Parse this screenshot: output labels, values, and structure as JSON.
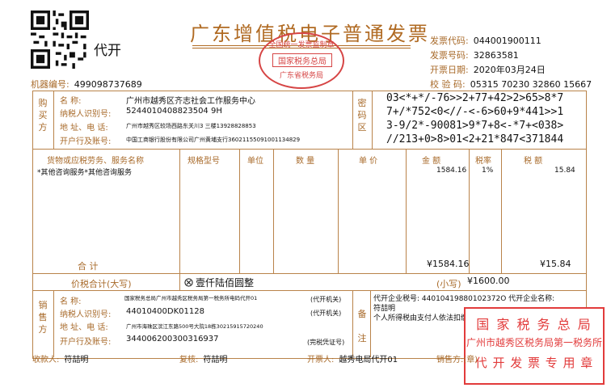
{
  "header": {
    "title": "广东增值税电子普通发票",
    "daikai": "代开",
    "seal_lines": [
      "全国统一发票监制章",
      "国家税务总局",
      "广东省税务局"
    ],
    "invoice_code_label": "发票代码:",
    "invoice_code": "044001900111",
    "invoice_no_label": "发票号码:",
    "invoice_no": "32863581",
    "date_label": "开票日期:",
    "date": "2020年03月24日",
    "check_label": "校 验 码:",
    "check_code": "05315 70230 32860 15667",
    "machine_label": "机器编号:",
    "machine_no": "499098737689"
  },
  "buyer": {
    "section_label": "购买方",
    "name_label": "名    称:",
    "name": "广州市越秀区齐志社会工作服务中心",
    "tax_id_label": "纳税人识别号:",
    "tax_id": "5244010408823504 9H",
    "addr_label": "地 址、电 话:",
    "addr": "广州市越秀区较场西路东关川3 三楼13928828853",
    "bank_label": "开户行及账号:",
    "bank": "中国工商银行股份有限公司广州黄埔支行36021155091001134829"
  },
  "cipher": {
    "section_label": "密码区",
    "lines": [
      "03<*+*/-76>>2+77+42>2>65>8*7",
      "7+/*752<0<//-<-6>60+9*441>>1",
      "3-9/2*-90081>9*7+8<-*7+<038>",
      "//213+0>8>01<2+21*847<371844"
    ]
  },
  "columns": {
    "goods": "货物或应税劳务、服务名称",
    "spec": "规格型号",
    "unit": "单位",
    "qty": "数 量",
    "price": "单 价",
    "amount": "金 额",
    "rate": "税率",
    "tax": "税 额"
  },
  "items": [
    {
      "goods": "*其他咨询服务*其他咨询服务",
      "amount": "1584.16",
      "rate": "1%",
      "tax": "15.84"
    }
  ],
  "totals": {
    "label": "合   计",
    "amount": "¥1584.16",
    "tax": "¥15.84",
    "grand_label": "价税合计(大写)",
    "grand_upper": "壹仟陆佰圆整",
    "grand_small_label": "(小写)",
    "grand_small": "¥1600.00"
  },
  "seller": {
    "section_label": "销售方",
    "name_label": "名    称:",
    "name": "国家税务总局广州市越秀区税务局第一税务所电码代开01",
    "name_tag": "(代开机关)",
    "tax_id_label": "纳税人识别号:",
    "tax_id": "44010400DK01128",
    "tax_id_tag": "(代开机关)",
    "addr_label": "地 址、电 话:",
    "addr": "广州市海珠区滨江东路500号大院18栋30215915720240",
    "bank_label": "开户行及账号:",
    "bank": "344006200300316937",
    "bank_tag": "(完税凭证号)"
  },
  "remarks": {
    "section_label": "备注",
    "line1": "代开企业税号: 44010419880102372O 代开企业名称:",
    "line2": "符喆明",
    "line3": "个人所得税由支付人依法扣缴"
  },
  "stamp": {
    "line1": "国 家 税 务 总 局",
    "line2": "广州市越秀区税务局第一税务所",
    "line3": "代 开 发 票 专 用 章"
  },
  "footer": {
    "payee_label": "收款人:",
    "payee": "符喆明",
    "reviewer_label": "复核:",
    "reviewer": "符喆明",
    "drawer_label": "开票人:",
    "drawer": "越秀电局代开01",
    "seller_label": "销售方:(章)"
  }
}
